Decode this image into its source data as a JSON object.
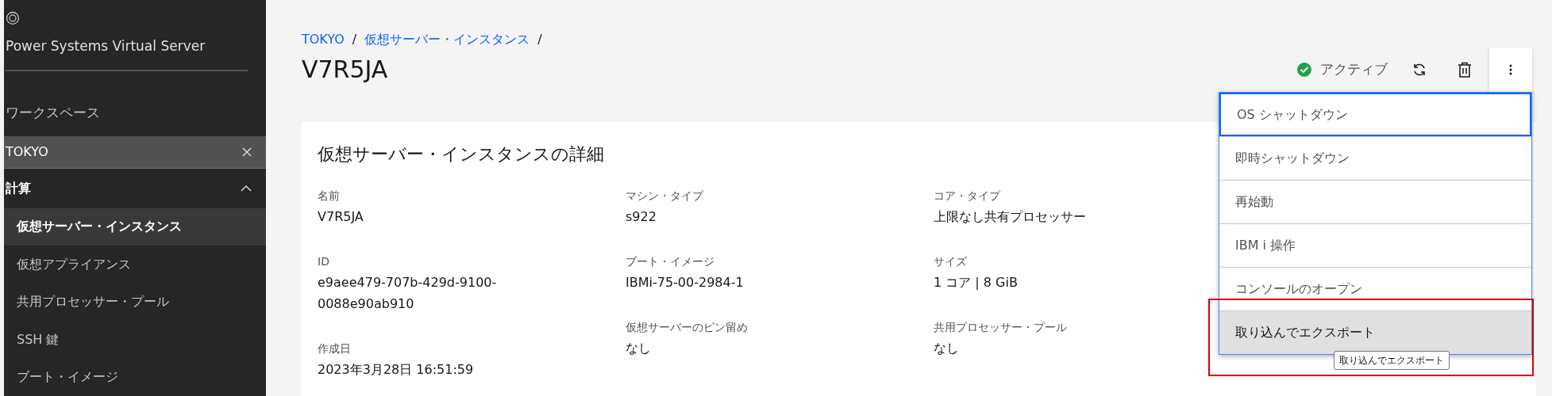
{
  "sidebar": {
    "product": "Power Systems Virtual Server",
    "workspace_label": "ワークスペース",
    "workspace": "TOKYO",
    "section": {
      "label": "計算",
      "expanded": true,
      "items": [
        {
          "label": "仮想サーバー・インスタンス",
          "selected": true
        },
        {
          "label": "仮想アプライアンス",
          "selected": false
        },
        {
          "label": "共用プロセッサー・プール",
          "selected": false
        },
        {
          "label": "SSH 鍵",
          "selected": false
        },
        {
          "label": "ブート・イメージ",
          "selected": false
        }
      ]
    }
  },
  "breadcrumb": {
    "separator": "/",
    "items": [
      "TOKYO",
      "仮想サーバー・インスタンス"
    ]
  },
  "title": "V7R5JA",
  "status": {
    "kind": "active",
    "label": "アクティブ"
  },
  "menu": {
    "open": true,
    "items": [
      {
        "label": "OS シャットダウン",
        "focused": true,
        "hovered": false
      },
      {
        "label": "即時シャットダウン",
        "focused": false,
        "hovered": false
      },
      {
        "label": "再始動",
        "focused": false,
        "hovered": false
      },
      {
        "label": "IBM i 操作",
        "focused": false,
        "hovered": false
      },
      {
        "label": "コンソールのオープン",
        "focused": false,
        "hovered": false
      },
      {
        "label": "取り込んでエクスポート",
        "focused": false,
        "hovered": true
      }
    ],
    "tooltip": "取り込んでエクスポート"
  },
  "details": {
    "title": "仮想サーバー・インスタンスの詳細",
    "columns": [
      [
        {
          "label": "名前",
          "value": "V7R5JA"
        },
        {
          "label": "ID",
          "value": "e9aee479-707b-429d-9100-0088e90ab910"
        },
        {
          "label": "作成日",
          "value": "2023年3月28日 16:51:59"
        }
      ],
      [
        {
          "label": "マシン・タイプ",
          "value": "s922"
        },
        {
          "label": "ブート・イメージ",
          "value": "IBMi-75-00-2984-1"
        },
        {
          "label": "仮想サーバーのピン留め",
          "value": "なし"
        }
      ],
      [
        {
          "label": "コア・タイプ",
          "value": "上限なし共有プロセッサー"
        },
        {
          "label": "サイズ",
          "value": "1 コア | 8 GiB"
        },
        {
          "label": "共用プロセッサー・プール",
          "value": "なし"
        }
      ]
    ]
  }
}
